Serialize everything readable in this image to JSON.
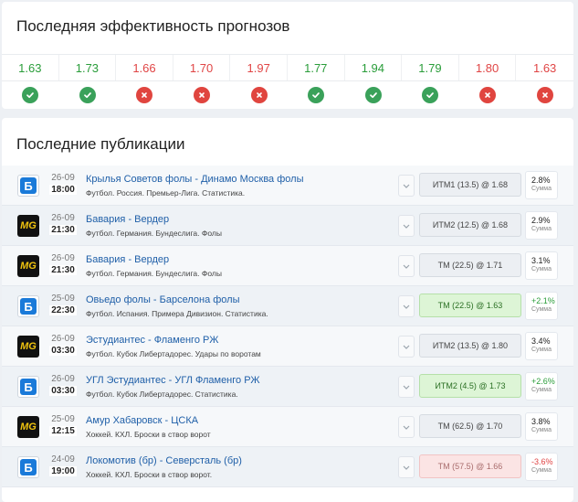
{
  "performance": {
    "title": "Последняя эффективность прогнозов",
    "items": [
      {
        "odds": "1.63",
        "outcome": "win"
      },
      {
        "odds": "1.73",
        "outcome": "win"
      },
      {
        "odds": "1.66",
        "outcome": "lose"
      },
      {
        "odds": "1.70",
        "outcome": "lose"
      },
      {
        "odds": "1.97",
        "outcome": "lose"
      },
      {
        "odds": "1.77",
        "outcome": "win"
      },
      {
        "odds": "1.94",
        "outcome": "win"
      },
      {
        "odds": "1.79",
        "outcome": "win"
      },
      {
        "odds": "1.80",
        "outcome": "lose"
      },
      {
        "odds": "1.63",
        "outcome": "lose"
      }
    ]
  },
  "publications": {
    "title": "Последние публикации",
    "result_label": "Сумма",
    "items": [
      {
        "bookmaker": "bb",
        "logo_text": "Б",
        "date": "26-09",
        "time": "18:00",
        "match": "Крылья Советов фолы - Динамо Москва фолы",
        "info": "Футбол. Россия. Премьер-Лига. Статистика.",
        "bet": "ИТМ1 (13.5) @ 1.68",
        "status": "pending",
        "result": "2.8%"
      },
      {
        "bookmaker": "mg",
        "logo_text": "MG",
        "date": "26-09",
        "time": "21:30",
        "match": "Бавария - Вердер",
        "info": "Футбол. Германия. Бундеслига. Фолы",
        "bet": "ИТМ2 (12.5) @ 1.68",
        "status": "pending",
        "result": "2.9%"
      },
      {
        "bookmaker": "mg",
        "logo_text": "MG",
        "date": "26-09",
        "time": "21:30",
        "match": "Бавария - Вердер",
        "info": "Футбол. Германия. Бундеслига. Фолы",
        "bet": "ТМ (22.5) @ 1.71",
        "status": "pending",
        "result": "3.1%"
      },
      {
        "bookmaker": "bb",
        "logo_text": "Б",
        "date": "25-09",
        "time": "22:30",
        "match": "Овьедо фолы - Барселона фолы",
        "info": "Футбол. Испания. Примера Дивизион. Статистика.",
        "bet": "ТМ (22.5) @ 1.63",
        "status": "win",
        "result": "+2.1%"
      },
      {
        "bookmaker": "mg",
        "logo_text": "MG",
        "date": "26-09",
        "time": "03:30",
        "match": "Эстудиантес - Фламенго РЖ",
        "info": "Футбол. Кубок Либертадорес. Удары по воротам",
        "bet": "ИТМ2 (13.5) @ 1.80",
        "status": "pending",
        "result": "3.4%"
      },
      {
        "bookmaker": "bb",
        "logo_text": "Б",
        "date": "26-09",
        "time": "03:30",
        "match": "УГЛ Эстудиантес - УГЛ Фламенго РЖ",
        "info": "Футбол. Кубок Либертадорес. Статистика.",
        "bet": "ИТМ2 (4.5) @ 1.73",
        "status": "win",
        "result": "+2.6%"
      },
      {
        "bookmaker": "mg",
        "logo_text": "MG",
        "date": "25-09",
        "time": "12:15",
        "match": "Амур Хабаровск - ЦСКА",
        "info": "Хоккей. КХЛ. Броски в створ ворот",
        "bet": "ТМ (62.5) @ 1.70",
        "status": "pending",
        "result": "3.8%"
      },
      {
        "bookmaker": "bb",
        "logo_text": "Б",
        "date": "24-09",
        "time": "19:00",
        "match": "Локомотив (бр) - Северсталь (бр)",
        "info": "Хоккей. КХЛ. Броски в створ ворот.",
        "bet": "ТМ (57.5) @ 1.66",
        "status": "lose",
        "result": "-3.6%"
      }
    ]
  },
  "colors": {
    "win": "#3aa15a",
    "lose": "#e0453f",
    "link": "#1f5fa8",
    "bookmaker_blue": "#1a7ad9"
  }
}
